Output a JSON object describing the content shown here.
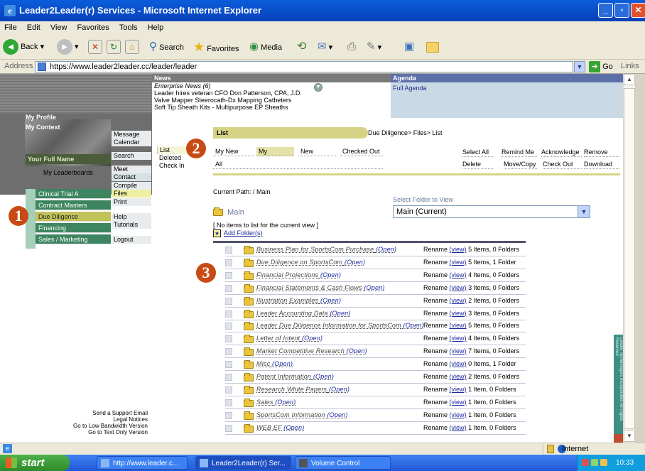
{
  "window": {
    "title": "Leader2Leader(r) Services - Microsoft Internet Explorer"
  },
  "menu": [
    "File",
    "Edit",
    "View",
    "Favorites",
    "Tools",
    "Help"
  ],
  "toolbar": {
    "back": "Back",
    "search": "Search",
    "favorites": "Favorites",
    "media": "Media"
  },
  "address": {
    "label": "Address",
    "url": "https://www.leader2leader.cc/leader/leader",
    "go": "Go",
    "links": "Links"
  },
  "news": {
    "heading": "News",
    "subheading": "Enterprise News (6)",
    "items": [
      "Leader hires veteran CFO Don Patterson, CPA, J.D.",
      "Valve Mapper Steerocath-Dx Mapping Catheters",
      "Soft Tip Sheath Kits - Multipurpose EP Sheaths"
    ]
  },
  "agenda": {
    "heading": "Agenda",
    "link": "Full Agenda"
  },
  "profile": {
    "my_profile": "My Profile",
    "my_context": "My Context",
    "your_full_name": "Your Full Name",
    "my_leaderboards": "My Leaderboards"
  },
  "nav_menu": [
    "Message",
    "Calendar",
    "Search",
    "Meet",
    "Contact",
    "Compile",
    "Files",
    "Print",
    "Help",
    "Tutorials",
    "Logout"
  ],
  "leaderboards": [
    "Clinical Trial A",
    "Contract Masters",
    "Due Diligence",
    "Financing",
    "Sales / Marketing"
  ],
  "submenu": [
    "List",
    "Deleted",
    "Check In"
  ],
  "footer_links": [
    "Send a Support Email",
    "Legal Notices",
    "Go to Low Bandwidth Version",
    "Go to Text Only Version"
  ],
  "list": {
    "title": "List",
    "crumb": "Due Diligence> Files> List",
    "tabs": [
      "My New",
      "My",
      "New",
      "Checked Out",
      "All"
    ],
    "actions_row1": [
      "Select All",
      "Remind Me",
      "Acknowledge",
      "Remove"
    ],
    "actions_row2": [
      "Delete",
      "Move/Copy",
      "Check Out",
      "Download"
    ],
    "current_path": "Current Path: / Main",
    "select_folder_label": "Select Folder to View",
    "select_folder_value": "Main (Current)",
    "main_folder": "Main",
    "no_items": "[ No items to list for the current view ]",
    "add_folder": "Add Folder(s)"
  },
  "folders": [
    {
      "name": "Business Plan for SportsCom Purchase",
      "info": "5 Items, 0 Folders"
    },
    {
      "name": "Due Diligence on SportsCom",
      "info": "5 Items, 1 Folder"
    },
    {
      "name": "Financial Projections",
      "info": "4 Items, 0 Folders"
    },
    {
      "name": "Financial Statements & Cash Flows",
      "info": "3 Items, 0 Folders"
    },
    {
      "name": "Illustration Examples",
      "info": "2 Items, 0 Folders"
    },
    {
      "name": "Leader Accounting Data",
      "info": "3 Items, 0 Folders"
    },
    {
      "name": "Leader Due Diligence Information for SportsCom",
      "info": "5 Items, 0 Folders"
    },
    {
      "name": "Letter of Intent",
      "info": "4 Items, 0 Folders"
    },
    {
      "name": "Market Competitive Research",
      "info": "7 Items, 0 Folders"
    },
    {
      "name": "Misc",
      "info": "0 Items, 1 Folder"
    },
    {
      "name": "Patent Information",
      "info": "2 Items, 0 Folders"
    },
    {
      "name": "Research White Papers",
      "info": "1 Item, 0 Folders"
    },
    {
      "name": "Sales",
      "info": "1 Item, 0 Folders"
    },
    {
      "name": "SportsCom Information",
      "info": "1 Item, 0 Folders"
    },
    {
      "name": "WEB EF",
      "info": "1 Item, 0 Folders"
    }
  ],
  "folder_labels": {
    "open": "(Open)",
    "rename": "Rename",
    "view": "(view)"
  },
  "callouts": [
    "1",
    "2",
    "3"
  ],
  "side_banner": "Leader Technologies Incorporated All Rights Reserved",
  "status": {
    "zone": "Internet"
  },
  "taskbar": {
    "start": "start",
    "tasks": [
      "http://www.leader.c...",
      "Leader2Leader(r) Ser...",
      "Volume Control"
    ],
    "clock": "10:33 AM"
  },
  "colors": {
    "olive": "#d6d387",
    "green_nav": "#3d8560",
    "callout": "#c84b16"
  }
}
